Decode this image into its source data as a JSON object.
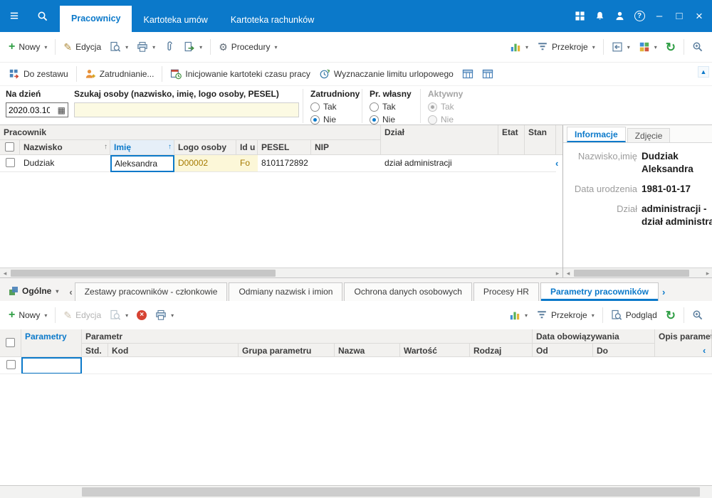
{
  "colors": {
    "accent": "#0b79ca",
    "field_yellow": "#fcfae3",
    "highlight_yellow": "#fcf7d8",
    "green": "#2f9e44",
    "red": "#d64333"
  },
  "icons": {
    "hamburger": "≡",
    "chevron_down": "▾",
    "chevron_left": "‹",
    "chevron_right": "›",
    "up_small": "▲",
    "down_small": "▼",
    "scroll_left": "◂",
    "scroll_right": "▸",
    "minimize": "–",
    "maximize": "□",
    "close": "×",
    "plus": "+",
    "pencil": "✎",
    "gear": "⚙",
    "refresh": "↻",
    "delete": "×",
    "calendar": "▦",
    "sort_up": "↑",
    "question": "?"
  },
  "titlebar": {
    "tabs": [
      {
        "label": "Pracownicy"
      },
      {
        "label": "Kartoteka umów"
      },
      {
        "label": "Kartoteka rachunków"
      }
    ]
  },
  "toolbar_top": {
    "nowy": "Nowy",
    "edycja": "Edycja",
    "procedury": "Procedury",
    "przekroje": "Przekroje"
  },
  "actions_bar": {
    "do_zestawu": "Do zestawu",
    "zatrudnianie": "Zatrudnianie...",
    "inicjowanie": "Inicjowanie kartoteki czasu pracy",
    "wyznaczanie": "Wyznaczanie limitu urlopowego"
  },
  "filters": {
    "na_dzien": {
      "label": "Na dzień",
      "value": "2020.03.10"
    },
    "szukaj": {
      "label": "Szukaj osoby (nazwisko, imię, logo osoby, PESEL)",
      "value": ""
    },
    "zatrudniony": {
      "label": "Zatrudniony",
      "tak": "Tak",
      "nie": "Nie",
      "selected": "Nie"
    },
    "pr_wlasny": {
      "label": "Pr. własny",
      "tak": "Tak",
      "nie": "Nie",
      "selected": "Nie"
    },
    "aktywny": {
      "label": "Aktywny",
      "tak": "Tak",
      "nie": "Nie",
      "selected": "Tak",
      "disabled": true
    }
  },
  "employees_table": {
    "groups": {
      "pracownik": "Pracownik",
      "dzial": "Dział",
      "etat": "Etat",
      "stan": "Stan"
    },
    "columns": {
      "nazwisko": "Nazwisko",
      "imie": "Imię",
      "logo": "Logo osoby",
      "id": "Id u",
      "pesel": "PESEL",
      "nip": "NIP"
    },
    "row": {
      "nazwisko": "Dudziak",
      "imie": "Aleksandra",
      "logo": "D00002",
      "id": "Fo",
      "pesel": "8101172892",
      "nip": "",
      "dzial": "dział administracji"
    }
  },
  "info_panel": {
    "tab_informacje": "Informacje",
    "tab_zdjecie": "Zdjęcie",
    "fields": [
      {
        "label": "Nazwisko,imię",
        "value": "Dudziak Aleksandra"
      },
      {
        "label": "Data urodzenia",
        "value": "1981-01-17"
      },
      {
        "label": "Dział",
        "value": "administracji - dział administracji"
      }
    ]
  },
  "detail_tabs": {
    "ogolne": "Ogólne",
    "tabs": [
      {
        "label": "Zestawy pracowników - członkowie"
      },
      {
        "label": "Odmiany nazwisk i imion"
      },
      {
        "label": "Ochrona danych osobowych"
      },
      {
        "label": "Procesy HR"
      },
      {
        "label": "Parametry pracowników"
      }
    ],
    "active": "Parametry pracowników"
  },
  "toolbar_bottom": {
    "nowy": "Nowy",
    "edycja": "Edycja",
    "przekroje": "Przekroje",
    "podglad": "Podgląd"
  },
  "params_table": {
    "col_parametry": "Parametry",
    "group_parametr": "Parametr",
    "group_data": "Data obowiązywania",
    "group_opis": "Opis parametru",
    "columns": {
      "std": "Std.",
      "kod": "Kod",
      "grupa": "Grupa parametru",
      "nazwa": "Nazwa",
      "wartosc": "Wartość",
      "rodzaj": "Rodzaj",
      "od": "Od",
      "do": "Do"
    }
  }
}
